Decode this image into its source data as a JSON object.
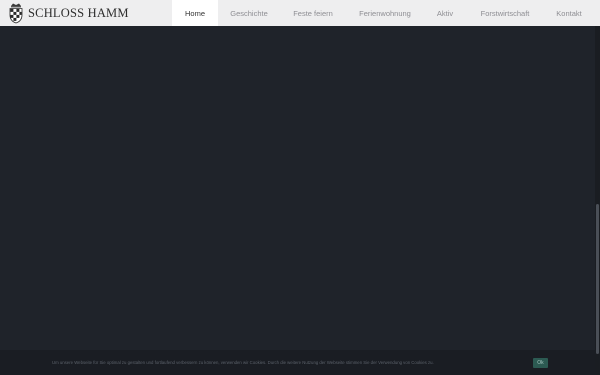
{
  "site": {
    "logo_text": "SCHLOSS HAMM"
  },
  "nav": {
    "items": [
      {
        "label": "Home",
        "active": true
      },
      {
        "label": "Geschichte",
        "active": false
      },
      {
        "label": "Feste feiern",
        "active": false
      },
      {
        "label": "Ferienwohnung",
        "active": false
      },
      {
        "label": "Aktiv",
        "active": false
      },
      {
        "label": "Forstwirtschaft",
        "active": false
      },
      {
        "label": "Kontakt",
        "active": false
      }
    ]
  },
  "cookie": {
    "text": "Um unsere Webseite für Sie optimal zu gestalten und fortlaufend verbessern zu können, verwenden wir Cookies. Durch die weitere Nutzung der Webseite stimmen Sie der Verwendung von Cookies zu.",
    "button_label": "Ok"
  },
  "colors": {
    "page_background": "#1f232a",
    "header_background": "#eeeeef",
    "cookie_button": "#2c5a52"
  },
  "icons": {
    "logo": "coat-of-arms-icon"
  }
}
